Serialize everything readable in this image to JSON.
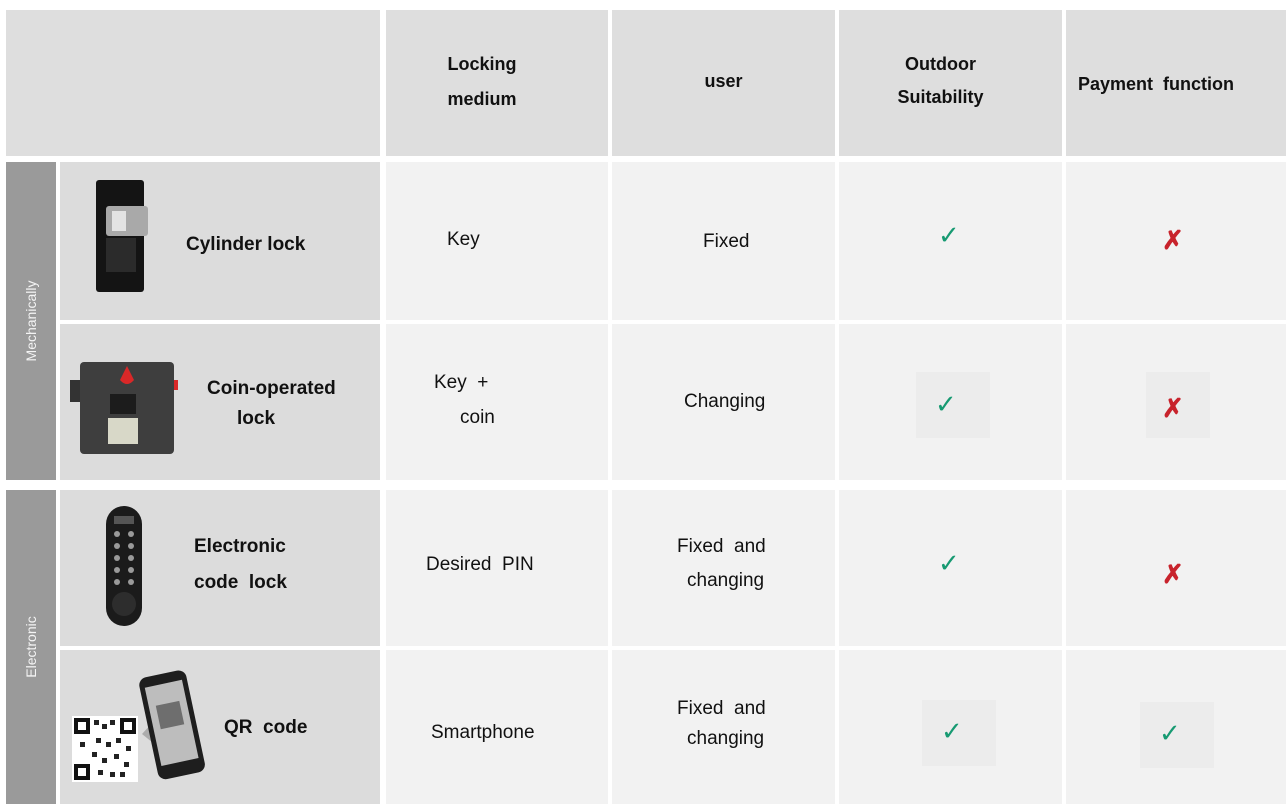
{
  "header": {
    "locking_medium_1": "Locking",
    "locking_medium_2": "medium",
    "user": "user",
    "outdoor_1": "Outdoor",
    "outdoor_2": "Suitability",
    "payment": "Payment  function"
  },
  "groups": {
    "mechanical": "Mechanically",
    "electronic": "Electronic"
  },
  "rows": [
    {
      "name_1": "Cylinder  lock",
      "medium_1": "Key",
      "user_1": "Fixed",
      "outdoor": "✓",
      "payment": "✗"
    },
    {
      "name_1": "Coin-operated",
      "name_2": "lock",
      "medium_1": "Key  +",
      "medium_2": "coin",
      "user_1": "Changing",
      "outdoor": "✓",
      "payment": "✗"
    },
    {
      "name_1": "Electronic",
      "name_2": "code  lock",
      "medium_1": "Desired  PIN",
      "user_1": "Fixed  and",
      "user_2": "changing",
      "outdoor": "✓",
      "payment": "✗"
    },
    {
      "name_1": "QR  code",
      "medium_1": "Smartphone",
      "user_1": "Fixed  and",
      "user_2": "changing",
      "outdoor": "✓",
      "payment": "✓"
    }
  ],
  "icons": {
    "check": "checkmark-icon",
    "cross": "cross-icon"
  },
  "colors": {
    "check": "#179a72",
    "cross": "#c8232c",
    "header_bg": "#dedede",
    "group_bg": "#9a9a9a"
  }
}
